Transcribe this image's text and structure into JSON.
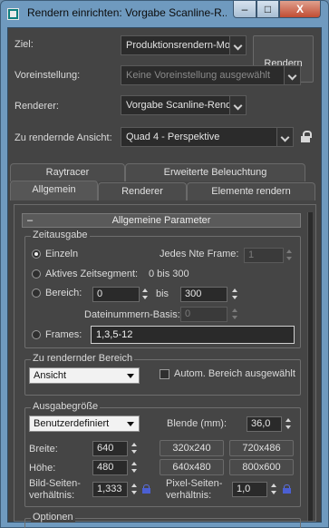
{
  "window": {
    "title": "Rendern einrichten: Vorgabe Scanline-R...",
    "minimize": "–",
    "maximize": "□",
    "close": "X"
  },
  "top": {
    "target_label": "Ziel:",
    "target_value": "Produktionsrendern-Mo­d",
    "preset_label": "Voreinstellung:",
    "preset_value": "Keine Voreinstellung ausgewählt",
    "renderer_label": "Renderer:",
    "renderer_value": "Vorgabe Scanline-Rende",
    "view_label": "Zu rendernde Ansicht:",
    "view_value": "Quad 4 - Perspektive",
    "render_button": "Rendern"
  },
  "tabs": {
    "row1": [
      "Raytracer",
      "Erweiterte Beleuchtung"
    ],
    "row2": [
      "Allgemein",
      "Renderer",
      "Elemente rendern"
    ],
    "active": "Allgemein"
  },
  "rollout": {
    "title": "Allgemeine Parameter",
    "toggle": "–"
  },
  "time_output": {
    "title": "Zeitausgabe",
    "single": "Einzeln",
    "nth_frame_label": "Jedes Nte Frame:",
    "nth_frame_value": "1",
    "active_segment": "Aktives Zeitsegment:",
    "active_segment_range": "0 bis 300",
    "range": "Bereich:",
    "range_from": "0",
    "range_to_label": "bis",
    "range_to": "300",
    "file_number_base_label": "Dateinummern-Basis:",
    "file_number_base_value": "0",
    "frames": "Frames:",
    "frames_value": "1,3,5-12"
  },
  "area": {
    "title": "Zu rendernder Bereich",
    "value": "Ansicht",
    "auto_label": "Autom. Bereich ausgewählt"
  },
  "output_size": {
    "title": "Ausgabegröße",
    "preset_value": "Benutzerdefiniert",
    "aperture_label": "Blende (mm):",
    "aperture_value": "36,0",
    "width_label": "Breite:",
    "width_value": "640",
    "height_label": "Höhe:",
    "height_value": "480",
    "presets": [
      "320x240",
      "720x486",
      "640x480",
      "800x600"
    ],
    "image_aspect_label_1": "Bild-Seiten-",
    "image_aspect_label_2": "verhältnis:",
    "image_aspect_value": "1,333",
    "pixel_aspect_label_1": "Pixel-Seiten-",
    "pixel_aspect_label_2": "verhältnis:",
    "pixel_aspect_value": "1,0"
  },
  "options": {
    "title": "Optionen"
  }
}
